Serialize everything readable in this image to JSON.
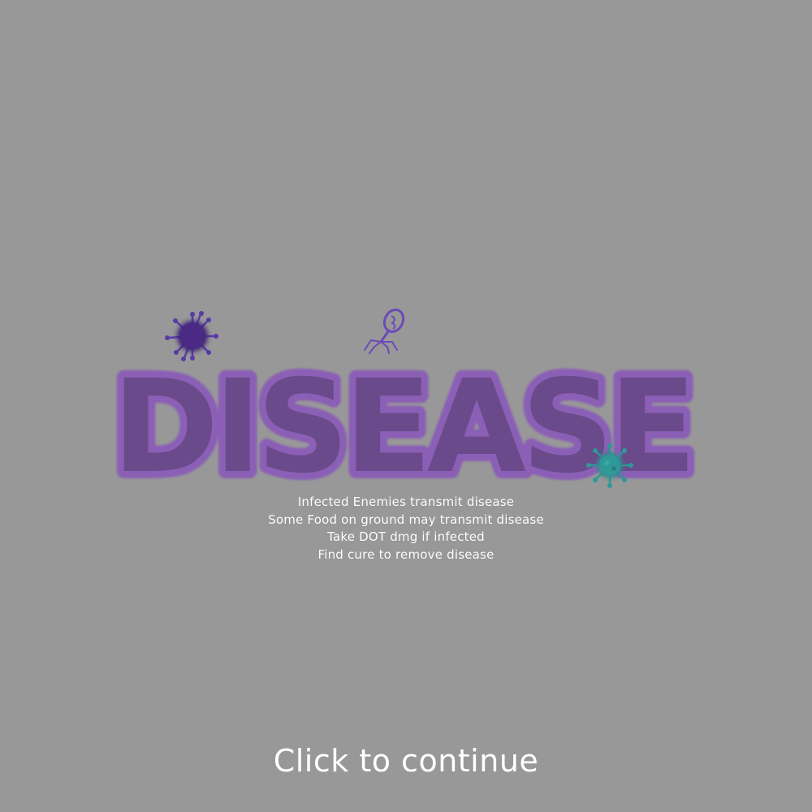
{
  "logo": {
    "text": "DISEASE",
    "fill_color": "#6a4a8a",
    "outline_color": "#8a5fb5"
  },
  "icons": {
    "virus_left": "dark-purple-virus-icon",
    "bacteriophage": "bacteriophage-icon",
    "virus_right": "teal-virus-icon"
  },
  "info_lines": [
    "Infected Enemies transmit disease",
    "Some Food on ground may transmit disease",
    "Take DOT dmg if infected",
    "Find cure to remove disease"
  ],
  "continue_label": "Click to continue",
  "colors": {
    "background": "#989898",
    "text": "#ffffff",
    "virus_dark": "#4a2a85",
    "virus_teal": "#2f9898",
    "phage": "#6a4ab8"
  }
}
